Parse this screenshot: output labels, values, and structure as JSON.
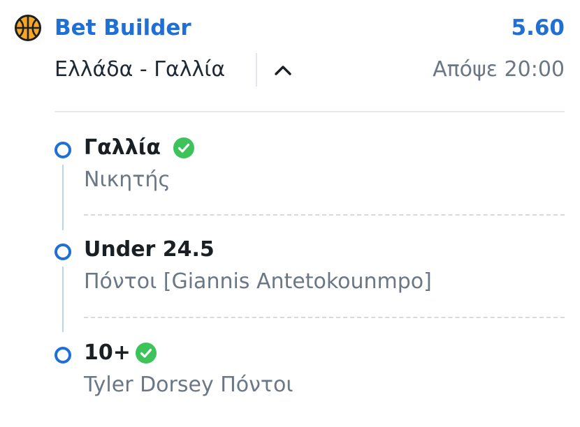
{
  "header": {
    "title": "Bet Builder",
    "odds": "5.60",
    "icon": "basketball-icon",
    "accent_color": "#1f6fd6"
  },
  "match": {
    "name": "Ελλάδα - Γαλλία",
    "time": "Απόψε 20:00",
    "collapse_icon": "chevron-up-icon"
  },
  "selections": [
    {
      "title": "Γαλλία",
      "subtitle": "Νικητής",
      "won": true
    },
    {
      "title": "Under 24.5",
      "subtitle": "Πόντοι [Giannis Antetokounmpo]",
      "won": false
    },
    {
      "title": "10+",
      "subtitle": "Tyler Dorsey Πόντοι",
      "won": true
    }
  ],
  "colors": {
    "check": "#3cc35a",
    "dot": "#1f6fd6",
    "muted_text": "#6b7785"
  }
}
